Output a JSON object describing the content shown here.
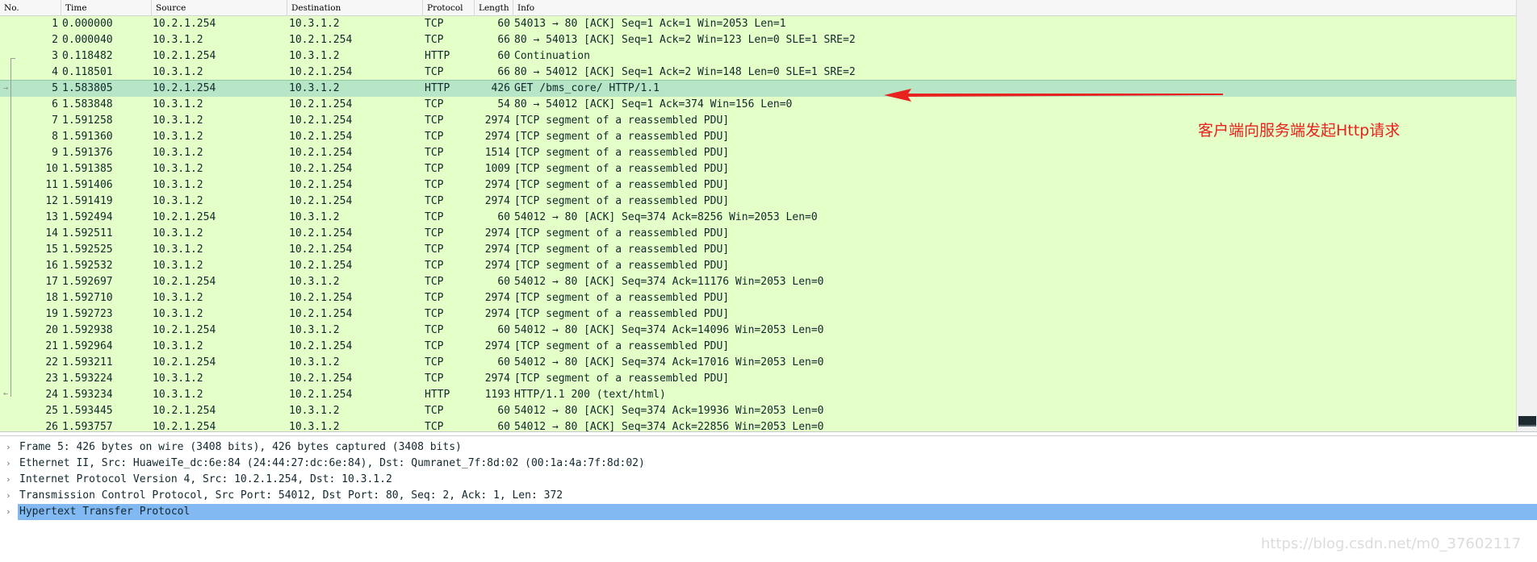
{
  "columns": {
    "no": "No.",
    "time": "Time",
    "source": "Source",
    "destination": "Destination",
    "protocol": "Protocol",
    "length": "Length",
    "info": "Info"
  },
  "packets": [
    {
      "no": "1",
      "time": "0.000000",
      "source": "10.2.1.254",
      "destination": "10.3.1.2",
      "protocol": "TCP",
      "length": "60",
      "info": "54013 → 80 [ACK] Seq=1 Ack=1 Win=2053 Len=1"
    },
    {
      "no": "2",
      "time": "0.000040",
      "source": "10.3.1.2",
      "destination": "10.2.1.254",
      "protocol": "TCP",
      "length": "66",
      "info": "80 → 54013 [ACK] Seq=1 Ack=2 Win=123 Len=0 SLE=1 SRE=2"
    },
    {
      "no": "3",
      "time": "0.118482",
      "source": "10.2.1.254",
      "destination": "10.3.1.2",
      "protocol": "HTTP",
      "length": "60",
      "info": "Continuation"
    },
    {
      "no": "4",
      "time": "0.118501",
      "source": "10.3.1.2",
      "destination": "10.2.1.254",
      "protocol": "TCP",
      "length": "66",
      "info": "80 → 54012 [ACK] Seq=1 Ack=2 Win=148 Len=0 SLE=1 SRE=2"
    },
    {
      "no": "5",
      "time": "1.583805",
      "source": "10.2.1.254",
      "destination": "10.3.1.2",
      "protocol": "HTTP",
      "length": "426",
      "info": "GET /bms_core/ HTTP/1.1"
    },
    {
      "no": "6",
      "time": "1.583848",
      "source": "10.3.1.2",
      "destination": "10.2.1.254",
      "protocol": "TCP",
      "length": "54",
      "info": "80 → 54012 [ACK] Seq=1 Ack=374 Win=156 Len=0"
    },
    {
      "no": "7",
      "time": "1.591258",
      "source": "10.3.1.2",
      "destination": "10.2.1.254",
      "protocol": "TCP",
      "length": "2974",
      "info": "[TCP segment of a reassembled PDU]"
    },
    {
      "no": "8",
      "time": "1.591360",
      "source": "10.3.1.2",
      "destination": "10.2.1.254",
      "protocol": "TCP",
      "length": "2974",
      "info": "[TCP segment of a reassembled PDU]"
    },
    {
      "no": "9",
      "time": "1.591376",
      "source": "10.3.1.2",
      "destination": "10.2.1.254",
      "protocol": "TCP",
      "length": "1514",
      "info": "[TCP segment of a reassembled PDU]"
    },
    {
      "no": "10",
      "time": "1.591385",
      "source": "10.3.1.2",
      "destination": "10.2.1.254",
      "protocol": "TCP",
      "length": "1009",
      "info": "[TCP segment of a reassembled PDU]"
    },
    {
      "no": "11",
      "time": "1.591406",
      "source": "10.3.1.2",
      "destination": "10.2.1.254",
      "protocol": "TCP",
      "length": "2974",
      "info": "[TCP segment of a reassembled PDU]"
    },
    {
      "no": "12",
      "time": "1.591419",
      "source": "10.3.1.2",
      "destination": "10.2.1.254",
      "protocol": "TCP",
      "length": "2974",
      "info": "[TCP segment of a reassembled PDU]"
    },
    {
      "no": "13",
      "time": "1.592494",
      "source": "10.2.1.254",
      "destination": "10.3.1.2",
      "protocol": "TCP",
      "length": "60",
      "info": "54012 → 80 [ACK] Seq=374 Ack=8256 Win=2053 Len=0"
    },
    {
      "no": "14",
      "time": "1.592511",
      "source": "10.3.1.2",
      "destination": "10.2.1.254",
      "protocol": "TCP",
      "length": "2974",
      "info": "[TCP segment of a reassembled PDU]"
    },
    {
      "no": "15",
      "time": "1.592525",
      "source": "10.3.1.2",
      "destination": "10.2.1.254",
      "protocol": "TCP",
      "length": "2974",
      "info": "[TCP segment of a reassembled PDU]"
    },
    {
      "no": "16",
      "time": "1.592532",
      "source": "10.3.1.2",
      "destination": "10.2.1.254",
      "protocol": "TCP",
      "length": "2974",
      "info": "[TCP segment of a reassembled PDU]"
    },
    {
      "no": "17",
      "time": "1.592697",
      "source": "10.2.1.254",
      "destination": "10.3.1.2",
      "protocol": "TCP",
      "length": "60",
      "info": "54012 → 80 [ACK] Seq=374 Ack=11176 Win=2053 Len=0"
    },
    {
      "no": "18",
      "time": "1.592710",
      "source": "10.3.1.2",
      "destination": "10.2.1.254",
      "protocol": "TCP",
      "length": "2974",
      "info": "[TCP segment of a reassembled PDU]"
    },
    {
      "no": "19",
      "time": "1.592723",
      "source": "10.3.1.2",
      "destination": "10.2.1.254",
      "protocol": "TCP",
      "length": "2974",
      "info": "[TCP segment of a reassembled PDU]"
    },
    {
      "no": "20",
      "time": "1.592938",
      "source": "10.2.1.254",
      "destination": "10.3.1.2",
      "protocol": "TCP",
      "length": "60",
      "info": "54012 → 80 [ACK] Seq=374 Ack=14096 Win=2053 Len=0"
    },
    {
      "no": "21",
      "time": "1.592964",
      "source": "10.3.1.2",
      "destination": "10.2.1.254",
      "protocol": "TCP",
      "length": "2974",
      "info": "[TCP segment of a reassembled PDU]"
    },
    {
      "no": "22",
      "time": "1.593211",
      "source": "10.2.1.254",
      "destination": "10.3.1.2",
      "protocol": "TCP",
      "length": "60",
      "info": "54012 → 80 [ACK] Seq=374 Ack=17016 Win=2053 Len=0"
    },
    {
      "no": "23",
      "time": "1.593224",
      "source": "10.3.1.2",
      "destination": "10.2.1.254",
      "protocol": "TCP",
      "length": "2974",
      "info": "[TCP segment of a reassembled PDU]"
    },
    {
      "no": "24",
      "time": "1.593234",
      "source": "10.3.1.2",
      "destination": "10.2.1.254",
      "protocol": "HTTP",
      "length": "1193",
      "info": "HTTP/1.1 200   (text/html)"
    },
    {
      "no": "25",
      "time": "1.593445",
      "source": "10.2.1.254",
      "destination": "10.3.1.2",
      "protocol": "TCP",
      "length": "60",
      "info": "54012 → 80 [ACK] Seq=374 Ack=19936 Win=2053 Len=0"
    },
    {
      "no": "26",
      "time": "1.593757",
      "source": "10.2.1.254",
      "destination": "10.3.1.2",
      "protocol": "TCP",
      "length": "60",
      "info": "54012 → 80 [ACK] Seq=374 Ack=22856 Win=2053 Len=0"
    }
  ],
  "selected_packet": "5",
  "annotation": {
    "text": "客户端向服务端发起Http请求",
    "color": "#e8221e"
  },
  "details": [
    {
      "text": "Frame 5: 426 bytes on wire (3408 bits), 426 bytes captured (3408 bits)",
      "selected": false
    },
    {
      "text": "Ethernet II, Src: HuaweiTe_dc:6e:84 (24:44:27:dc:6e:84), Dst: Qumranet_7f:8d:02 (00:1a:4a:7f:8d:02)",
      "selected": false
    },
    {
      "text": "Internet Protocol Version 4, Src: 10.2.1.254, Dst: 10.3.1.2",
      "selected": false
    },
    {
      "text": "Transmission Control Protocol, Src Port: 54012, Dst Port: 80, Seq: 2, Ack: 1, Len: 372",
      "selected": false
    },
    {
      "text": "Hypertext Transfer Protocol",
      "selected": true
    }
  ],
  "watermark": "https://blog.csdn.net/m0_37602117",
  "colors": {
    "row_tcp_bg": "#e4ffc7",
    "row_selected_bg": "#b7e6c7",
    "detail_selected_bg": "#82b9f2"
  }
}
